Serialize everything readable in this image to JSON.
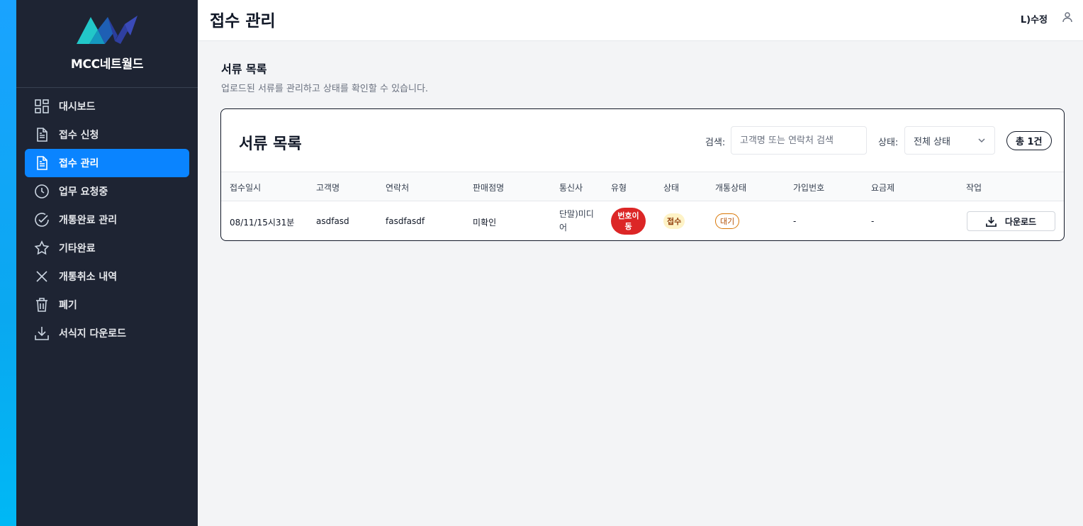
{
  "brand": {
    "name": "MCC네트월드"
  },
  "sidebar": {
    "items": [
      {
        "label": "대시보드",
        "icon": "dashboard-icon",
        "active": false
      },
      {
        "label": "접수 신청",
        "icon": "document-icon",
        "active": false
      },
      {
        "label": "접수 관리",
        "icon": "document-icon",
        "active": true
      },
      {
        "label": "업무 요청중",
        "icon": "clock-icon",
        "active": false
      },
      {
        "label": "개통완료 관리",
        "icon": "check-circle-icon",
        "active": false
      },
      {
        "label": "기타완료",
        "icon": "star-icon",
        "active": false
      },
      {
        "label": "개통취소 내역",
        "icon": "x-icon",
        "active": false
      },
      {
        "label": "폐기",
        "icon": "trash-icon",
        "active": false
      },
      {
        "label": "서식지 다운로드",
        "icon": "download-icon",
        "active": false
      }
    ]
  },
  "header": {
    "title": "접수 관리",
    "user": "L)수정"
  },
  "section": {
    "title": "서류 목록",
    "subtitle": "업로드된 서류를 관리하고 상태를 확인할 수 있습니다."
  },
  "card": {
    "title": "서류 목록",
    "search_label": "검색:",
    "search_placeholder": "고객명 또는 연락처 검색",
    "status_label": "상태:",
    "status_value": "전체 상태",
    "total": "총 1건"
  },
  "table": {
    "headers": [
      "접수일시",
      "고객명",
      "연락처",
      "판매점명",
      "통신사",
      "유형",
      "상태",
      "개통상태",
      "가입번호",
      "요금제",
      "작업"
    ],
    "rows": [
      {
        "date": "08/11/15시31분",
        "customer": "asdfasd",
        "contact": "fasdfasdf",
        "store": "미확인",
        "carrier": "단말)미디어",
        "type": "번호이동",
        "status": "접수",
        "open_status": "대기",
        "join_no": "-",
        "plan": "-",
        "action": "다운로드"
      }
    ]
  },
  "colors": {
    "accent": "#0a84ff",
    "sidebar_bg": "#1e2433",
    "type_badge": "#dc2626"
  }
}
